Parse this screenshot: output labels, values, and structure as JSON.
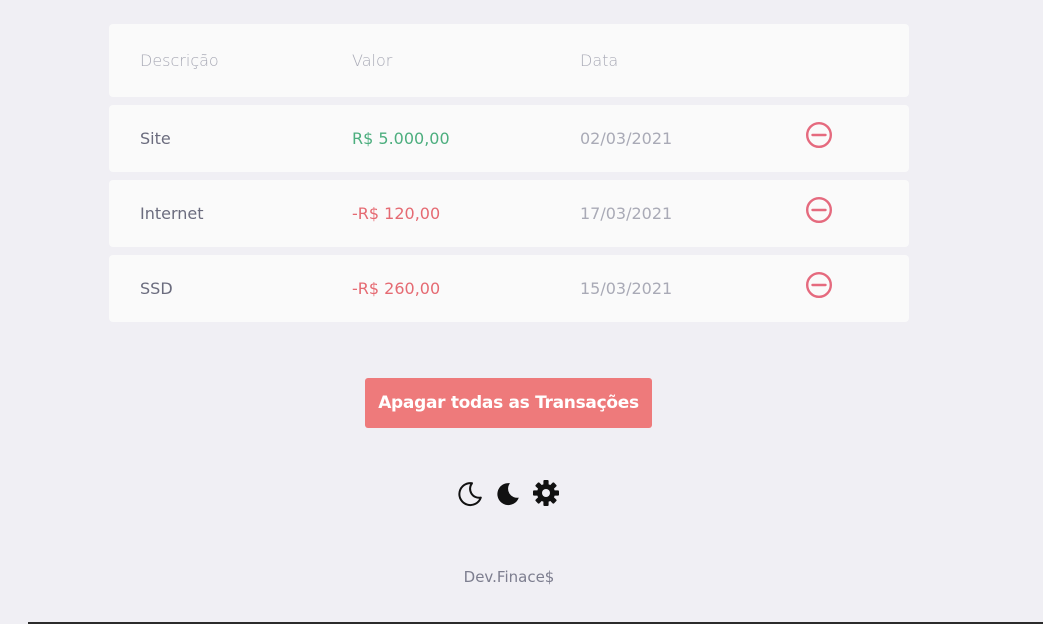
{
  "table": {
    "headers": {
      "description": "Descrição",
      "amount": "Valor",
      "date": "Data"
    },
    "rows": [
      {
        "description": "Site",
        "amount": "R$ 5.000,00",
        "date": "02/03/2021",
        "type": "income"
      },
      {
        "description": "Internet",
        "amount": "-R$ 120,00",
        "date": "17/03/2021",
        "type": "expense"
      },
      {
        "description": "SSD",
        "amount": "-R$ 260,00",
        "date": "15/03/2021",
        "type": "expense"
      }
    ]
  },
  "actions": {
    "clear_all_label": "Apagar todas as Transações"
  },
  "theme_icons": [
    "moon-outline-icon",
    "moon-filled-icon",
    "gear-icon"
  ],
  "footer": {
    "brand": "Dev.Finace$"
  },
  "colors": {
    "background": "#f0eff4",
    "income": "#4cae7e",
    "expense": "#e56a72",
    "clear_button": "#ee7a7b"
  }
}
